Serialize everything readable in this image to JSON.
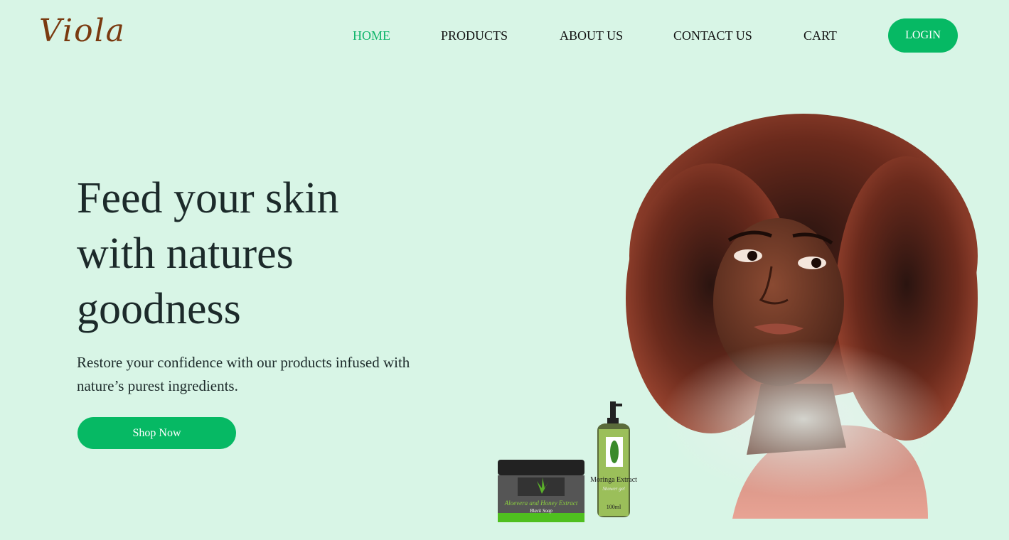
{
  "brand": {
    "logo_text": "Viola"
  },
  "nav": {
    "items": [
      {
        "label": "HOME",
        "active": true
      },
      {
        "label": "PRODUCTS",
        "active": false
      },
      {
        "label": "ABOUT US",
        "active": false
      },
      {
        "label": "CONTACT US",
        "active": false
      },
      {
        "label": "CART",
        "active": false
      }
    ],
    "login_label": "LOGIN"
  },
  "hero": {
    "title_lines": [
      "Feed your skin",
      "with natures",
      "goodness"
    ],
    "subtitle": "Restore your confidence with our products infused with nature’s purest ingredients.",
    "cta_label": "Shop Now"
  },
  "products": {
    "jar_label": "Aloevera and Honey Extract",
    "jar_sublabel": "Black Soap",
    "bottle_label": "Moringa Extract",
    "bottle_sublabel": "Shower gel",
    "bottle_volume": "100ml"
  },
  "colors": {
    "background": "#d8f5e6",
    "accent": "#06b964",
    "text": "#1c2a2a",
    "logo": "#7a3a10"
  }
}
